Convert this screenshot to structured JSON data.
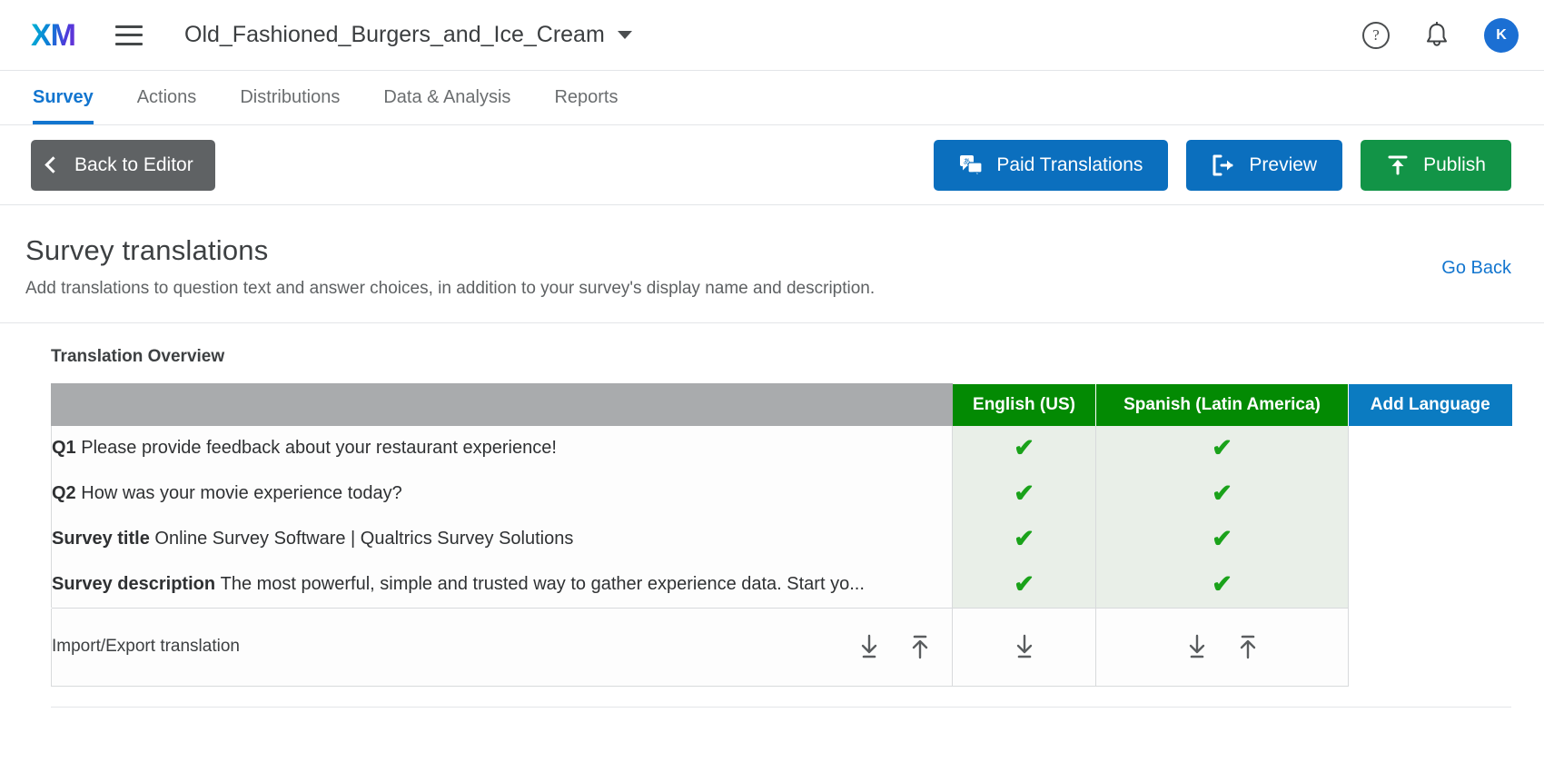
{
  "topbar": {
    "logo": "XM",
    "menu_icon": "hamburger-icon",
    "survey_name": "Old_Fashioned_Burgers_and_Ice_Cream",
    "help_glyph": "?",
    "avatar_initial": "K",
    "avatar_color": "#1b6fd3"
  },
  "navtabs": [
    {
      "label": "Survey",
      "active": true
    },
    {
      "label": "Actions",
      "active": false
    },
    {
      "label": "Distributions",
      "active": false
    },
    {
      "label": "Data & Analysis",
      "active": false
    },
    {
      "label": "Reports",
      "active": false
    }
  ],
  "actionbar": {
    "back_label": "Back to Editor",
    "paid_translations_label": "Paid Translations",
    "preview_label": "Preview",
    "publish_label": "Publish",
    "back_color": "#5f6264",
    "blue_color": "#0b6fbe",
    "green_color": "#129447"
  },
  "pagehead": {
    "title": "Survey translations",
    "description": "Add translations to question text and answer choices, in addition to your survey's display name and description.",
    "go_back_label": "Go Back",
    "link_color": "#1275cf"
  },
  "table": {
    "section_title": "Translation Overview",
    "columns": {
      "blank": "",
      "lang1": "English (US)",
      "lang2": "Spanish (Latin America)",
      "add": "Add Language"
    },
    "header_colors": {
      "lang": "#038a03",
      "add": "#0b7bc1",
      "blank": "#a9abad"
    },
    "check_glyph": "✔",
    "check_color": "#1aa21a",
    "rows": [
      {
        "key": "Q1",
        "text": "Please provide feedback about your restaurant experience!",
        "lang1": "✔",
        "lang2": "✔"
      },
      {
        "key": "Q2",
        "text": "How was your movie experience today?",
        "lang1": "✔",
        "lang2": "✔"
      },
      {
        "key": "Survey title",
        "text": "Online Survey Software | Qualtrics Survey Solutions",
        "lang1": "✔",
        "lang2": "✔"
      },
      {
        "key": "Survey description",
        "text": "The most powerful, simple and trusted way to gather experience data. Start yo...",
        "lang1": "✔",
        "lang2": "✔"
      }
    ],
    "import_export": {
      "label": "Import/Export translation",
      "download_icon": "download-icon",
      "upload_icon": "upload-icon"
    }
  }
}
